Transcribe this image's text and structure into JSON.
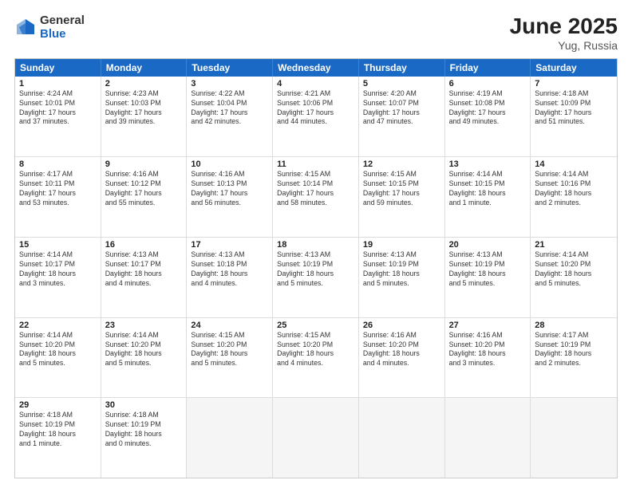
{
  "logo": {
    "general": "General",
    "blue": "Blue"
  },
  "title": "June 2025",
  "location": "Yug, Russia",
  "days": [
    "Sunday",
    "Monday",
    "Tuesday",
    "Wednesday",
    "Thursday",
    "Friday",
    "Saturday"
  ],
  "rows": [
    [
      {
        "day": "1",
        "lines": [
          "Sunrise: 4:24 AM",
          "Sunset: 10:01 PM",
          "Daylight: 17 hours",
          "and 37 minutes."
        ]
      },
      {
        "day": "2",
        "lines": [
          "Sunrise: 4:23 AM",
          "Sunset: 10:03 PM",
          "Daylight: 17 hours",
          "and 39 minutes."
        ]
      },
      {
        "day": "3",
        "lines": [
          "Sunrise: 4:22 AM",
          "Sunset: 10:04 PM",
          "Daylight: 17 hours",
          "and 42 minutes."
        ]
      },
      {
        "day": "4",
        "lines": [
          "Sunrise: 4:21 AM",
          "Sunset: 10:06 PM",
          "Daylight: 17 hours",
          "and 44 minutes."
        ]
      },
      {
        "day": "5",
        "lines": [
          "Sunrise: 4:20 AM",
          "Sunset: 10:07 PM",
          "Daylight: 17 hours",
          "and 47 minutes."
        ]
      },
      {
        "day": "6",
        "lines": [
          "Sunrise: 4:19 AM",
          "Sunset: 10:08 PM",
          "Daylight: 17 hours",
          "and 49 minutes."
        ]
      },
      {
        "day": "7",
        "lines": [
          "Sunrise: 4:18 AM",
          "Sunset: 10:09 PM",
          "Daylight: 17 hours",
          "and 51 minutes."
        ]
      }
    ],
    [
      {
        "day": "8",
        "lines": [
          "Sunrise: 4:17 AM",
          "Sunset: 10:11 PM",
          "Daylight: 17 hours",
          "and 53 minutes."
        ]
      },
      {
        "day": "9",
        "lines": [
          "Sunrise: 4:16 AM",
          "Sunset: 10:12 PM",
          "Daylight: 17 hours",
          "and 55 minutes."
        ]
      },
      {
        "day": "10",
        "lines": [
          "Sunrise: 4:16 AM",
          "Sunset: 10:13 PM",
          "Daylight: 17 hours",
          "and 56 minutes."
        ]
      },
      {
        "day": "11",
        "lines": [
          "Sunrise: 4:15 AM",
          "Sunset: 10:14 PM",
          "Daylight: 17 hours",
          "and 58 minutes."
        ]
      },
      {
        "day": "12",
        "lines": [
          "Sunrise: 4:15 AM",
          "Sunset: 10:15 PM",
          "Daylight: 17 hours",
          "and 59 minutes."
        ]
      },
      {
        "day": "13",
        "lines": [
          "Sunrise: 4:14 AM",
          "Sunset: 10:15 PM",
          "Daylight: 18 hours",
          "and 1 minute."
        ]
      },
      {
        "day": "14",
        "lines": [
          "Sunrise: 4:14 AM",
          "Sunset: 10:16 PM",
          "Daylight: 18 hours",
          "and 2 minutes."
        ]
      }
    ],
    [
      {
        "day": "15",
        "lines": [
          "Sunrise: 4:14 AM",
          "Sunset: 10:17 PM",
          "Daylight: 18 hours",
          "and 3 minutes."
        ]
      },
      {
        "day": "16",
        "lines": [
          "Sunrise: 4:13 AM",
          "Sunset: 10:17 PM",
          "Daylight: 18 hours",
          "and 4 minutes."
        ]
      },
      {
        "day": "17",
        "lines": [
          "Sunrise: 4:13 AM",
          "Sunset: 10:18 PM",
          "Daylight: 18 hours",
          "and 4 minutes."
        ]
      },
      {
        "day": "18",
        "lines": [
          "Sunrise: 4:13 AM",
          "Sunset: 10:19 PM",
          "Daylight: 18 hours",
          "and 5 minutes."
        ]
      },
      {
        "day": "19",
        "lines": [
          "Sunrise: 4:13 AM",
          "Sunset: 10:19 PM",
          "Daylight: 18 hours",
          "and 5 minutes."
        ]
      },
      {
        "day": "20",
        "lines": [
          "Sunrise: 4:13 AM",
          "Sunset: 10:19 PM",
          "Daylight: 18 hours",
          "and 5 minutes."
        ]
      },
      {
        "day": "21",
        "lines": [
          "Sunrise: 4:14 AM",
          "Sunset: 10:20 PM",
          "Daylight: 18 hours",
          "and 5 minutes."
        ]
      }
    ],
    [
      {
        "day": "22",
        "lines": [
          "Sunrise: 4:14 AM",
          "Sunset: 10:20 PM",
          "Daylight: 18 hours",
          "and 5 minutes."
        ]
      },
      {
        "day": "23",
        "lines": [
          "Sunrise: 4:14 AM",
          "Sunset: 10:20 PM",
          "Daylight: 18 hours",
          "and 5 minutes."
        ]
      },
      {
        "day": "24",
        "lines": [
          "Sunrise: 4:15 AM",
          "Sunset: 10:20 PM",
          "Daylight: 18 hours",
          "and 5 minutes."
        ]
      },
      {
        "day": "25",
        "lines": [
          "Sunrise: 4:15 AM",
          "Sunset: 10:20 PM",
          "Daylight: 18 hours",
          "and 4 minutes."
        ]
      },
      {
        "day": "26",
        "lines": [
          "Sunrise: 4:16 AM",
          "Sunset: 10:20 PM",
          "Daylight: 18 hours",
          "and 4 minutes."
        ]
      },
      {
        "day": "27",
        "lines": [
          "Sunrise: 4:16 AM",
          "Sunset: 10:20 PM",
          "Daylight: 18 hours",
          "and 3 minutes."
        ]
      },
      {
        "day": "28",
        "lines": [
          "Sunrise: 4:17 AM",
          "Sunset: 10:19 PM",
          "Daylight: 18 hours",
          "and 2 minutes."
        ]
      }
    ],
    [
      {
        "day": "29",
        "lines": [
          "Sunrise: 4:18 AM",
          "Sunset: 10:19 PM",
          "Daylight: 18 hours",
          "and 1 minute."
        ]
      },
      {
        "day": "30",
        "lines": [
          "Sunrise: 4:18 AM",
          "Sunset: 10:19 PM",
          "Daylight: 18 hours",
          "and 0 minutes."
        ]
      },
      null,
      null,
      null,
      null,
      null
    ]
  ]
}
